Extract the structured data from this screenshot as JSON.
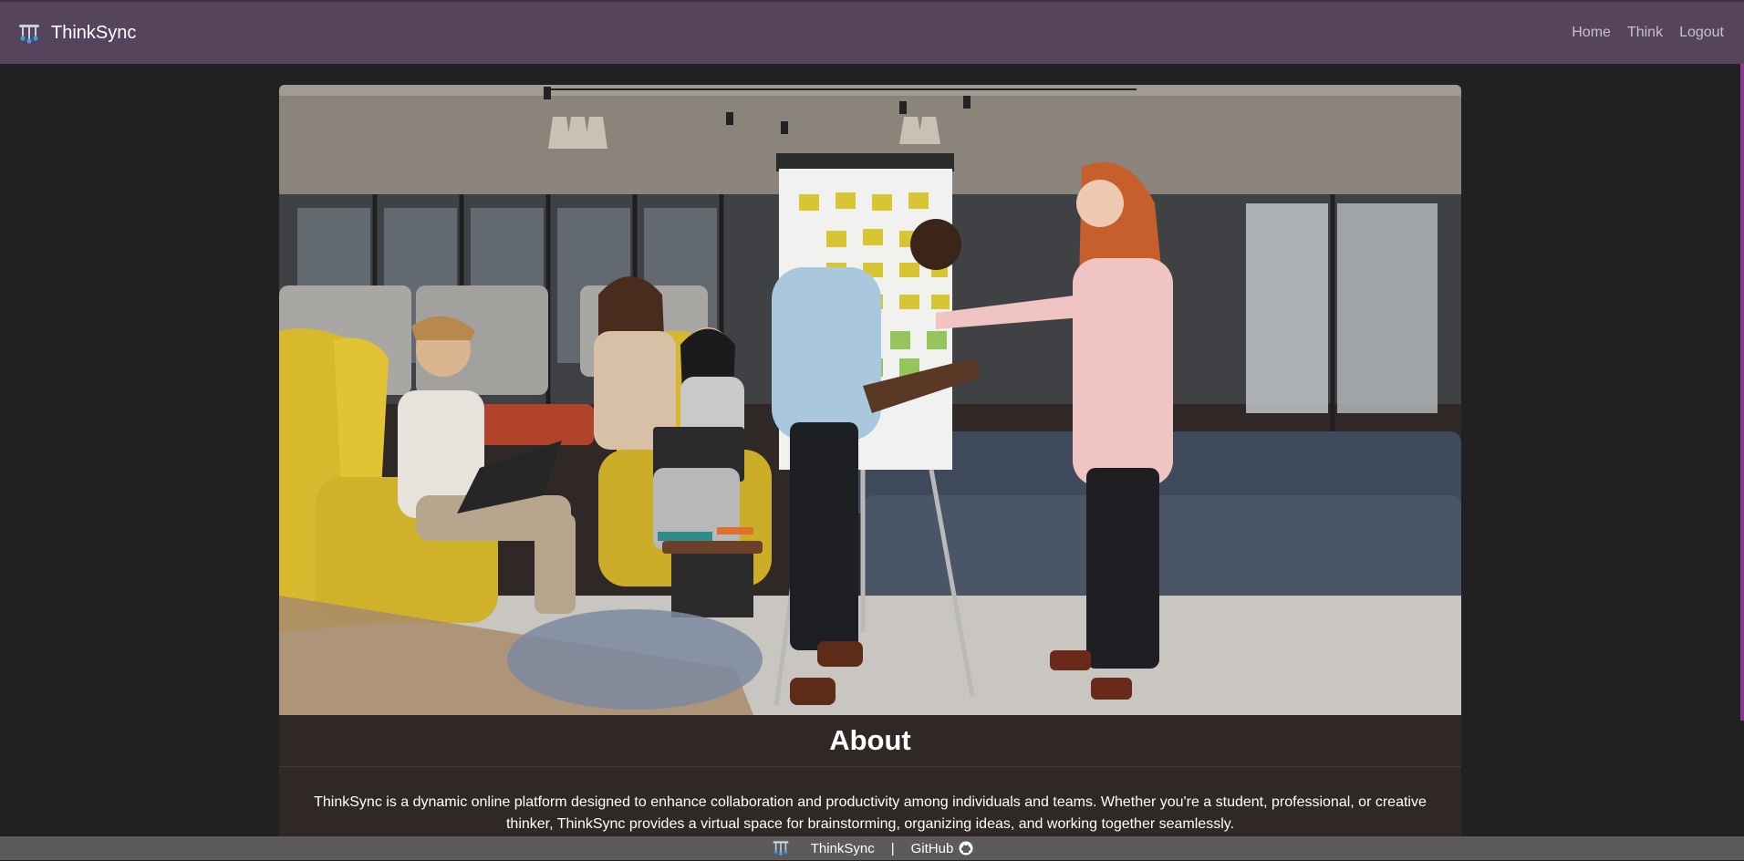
{
  "navbar": {
    "brand": "ThinkSync",
    "brand_icon": "brain-network-icon",
    "links": [
      "Home",
      "Think",
      "Logout"
    ]
  },
  "hero": {
    "image": "team-brainstorming-photo"
  },
  "about": {
    "title": "About",
    "body": "ThinkSync is a dynamic online platform designed to enhance collaboration and productivity among individuals and teams. Whether you're a student, professional, or creative thinker, ThinkSync provides a virtual space for brainstorming, organizing ideas, and working together seamlessly."
  },
  "footer": {
    "brand": "ThinkSync",
    "separator": "|",
    "link": "GitHub",
    "link_icon": "github-icon"
  },
  "colors": {
    "navbar": "#56445d",
    "page_bg": "#212121",
    "card_bg": "#302826",
    "footer_bg": "#5c5a5a"
  }
}
